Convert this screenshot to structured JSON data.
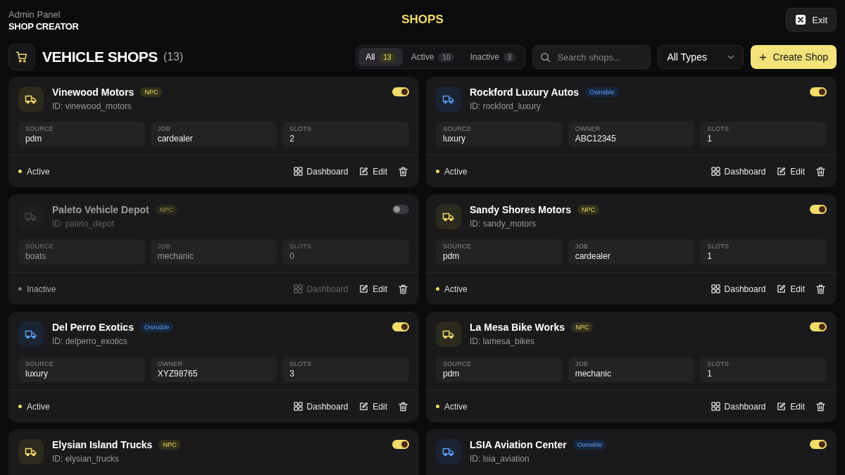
{
  "header": {
    "subtitle": "Admin Panel",
    "title": "SHOP CREATOR",
    "center_title": "SHOPS",
    "exit_label": "Exit"
  },
  "section": {
    "title": "VEHICLE SHOPS",
    "count": "(13)"
  },
  "filters": [
    {
      "label": "All",
      "count": "13",
      "selected": true
    },
    {
      "label": "Active",
      "count": "10",
      "selected": false
    },
    {
      "label": "Inactive",
      "count": "3",
      "selected": false
    }
  ],
  "search": {
    "placeholder": "Search shops..."
  },
  "type_select": {
    "value": "All Types"
  },
  "create_button": {
    "label": "Create Shop"
  },
  "shops": [
    {
      "name": "Vinewood Motors",
      "kind": "npc",
      "badge": "NPC",
      "id": "ID: vinewood_motors",
      "active": true,
      "fields": [
        {
          "label": "SOURCE",
          "value": "pdm"
        },
        {
          "label": "JOB",
          "value": "cardealer"
        },
        {
          "label": "SLOTS",
          "value": "2"
        }
      ],
      "status": "Active",
      "actions": [
        "Dashboard",
        "Edit"
      ]
    },
    {
      "name": "Rockford Luxury Autos",
      "kind": "ownable",
      "badge": "Ownable",
      "id": "ID: rockford_luxury",
      "active": true,
      "fields": [
        {
          "label": "SOURCE",
          "value": "luxury"
        },
        {
          "label": "OWNER",
          "value": "ABC12345"
        },
        {
          "label": "SLOTS",
          "value": "1"
        }
      ],
      "status": "Active",
      "actions": [
        "Dashboard",
        "Edit"
      ]
    },
    {
      "name": "Paleto Vehicle Depot",
      "kind": "npc",
      "badge": "NPC",
      "id": "ID: paleto_depot",
      "active": false,
      "fields": [
        {
          "label": "SOURCE",
          "value": "boats"
        },
        {
          "label": "JOB",
          "value": "mechanic"
        },
        {
          "label": "SLOTS",
          "value": "0"
        }
      ],
      "status": "Inactive",
      "actions": [
        "Dashboard",
        "Edit"
      ]
    },
    {
      "name": "Sandy Shores Motors",
      "kind": "npc",
      "badge": "NPC",
      "id": "ID: sandy_motors",
      "active": true,
      "fields": [
        {
          "label": "SOURCE",
          "value": "pdm"
        },
        {
          "label": "JOB",
          "value": "cardealer"
        },
        {
          "label": "SLOTS",
          "value": "1"
        }
      ],
      "status": "Active",
      "actions": [
        "Dashboard",
        "Edit"
      ]
    },
    {
      "name": "Del Perro Exotics",
      "kind": "ownable",
      "badge": "Ownable",
      "id": "ID: delperro_exotics",
      "active": true,
      "fields": [
        {
          "label": "SOURCE",
          "value": "luxury"
        },
        {
          "label": "OWNER",
          "value": "XYZ98765"
        },
        {
          "label": "SLOTS",
          "value": "3"
        }
      ],
      "status": "Active",
      "actions": [
        "Dashboard",
        "Edit"
      ]
    },
    {
      "name": "La Mesa Bike Works",
      "kind": "npc",
      "badge": "NPC",
      "id": "ID: lamesa_bikes",
      "active": true,
      "fields": [
        {
          "label": "SOURCE",
          "value": "pdm"
        },
        {
          "label": "JOB",
          "value": "mechanic"
        },
        {
          "label": "SLOTS",
          "value": "1"
        }
      ],
      "status": "Active",
      "actions": [
        "Dashboard",
        "Edit"
      ]
    },
    {
      "name": "Elysian Island Trucks",
      "kind": "npc",
      "badge": "NPC",
      "id": "ID: elysian_trucks",
      "active": true
    },
    {
      "name": "LSIA Aviation Center",
      "kind": "ownable",
      "badge": "Ownable",
      "id": "ID: lsia_aviation",
      "active": true
    }
  ]
}
